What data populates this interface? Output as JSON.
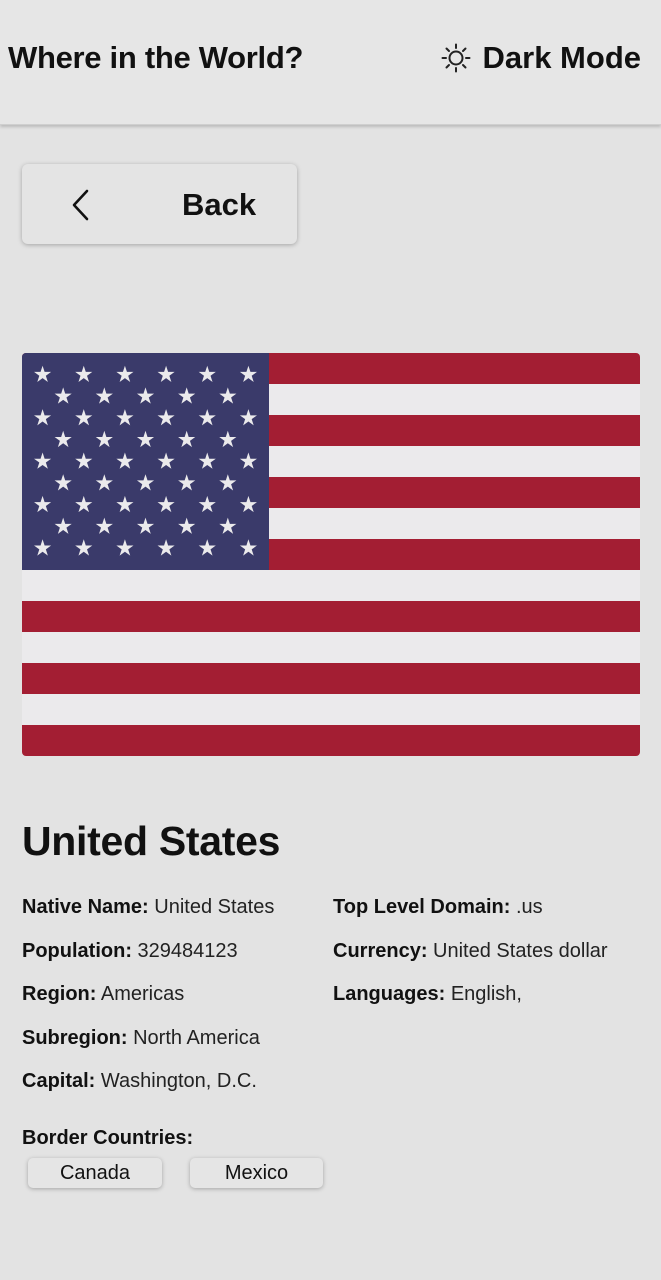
{
  "header": {
    "title": "Where in the World?",
    "mode_toggle_label": "Dark Mode",
    "mode_icon": "sun-icon"
  },
  "back_button": {
    "label": "Back",
    "icon": "chevron-left-icon"
  },
  "flag": {
    "icon": "us-flag-image",
    "colors": {
      "red": "#a31e33",
      "white": "#ebeaec",
      "blue": "#3a3a6a"
    }
  },
  "country": {
    "name": "United States",
    "details_left": [
      {
        "key": "Native Name:",
        "value": "United States"
      },
      {
        "key": "Population:",
        "value": "329484123"
      },
      {
        "key": "Region:",
        "value": "Americas"
      },
      {
        "key": "Subregion:",
        "value": "North America"
      },
      {
        "key": "Capital:",
        "value": "Washington, D.C."
      }
    ],
    "details_right": [
      {
        "key": "Top Level Domain:",
        "value": ".us"
      },
      {
        "key": "Currency:",
        "value": "United States dollar"
      },
      {
        "key": "Languages:",
        "value": "English,"
      }
    ],
    "border_label": "Border Countries:",
    "borders": [
      "Canada",
      "Mexico"
    ]
  },
  "colors": {
    "background": "#e3e3e3",
    "text": "#111111"
  }
}
